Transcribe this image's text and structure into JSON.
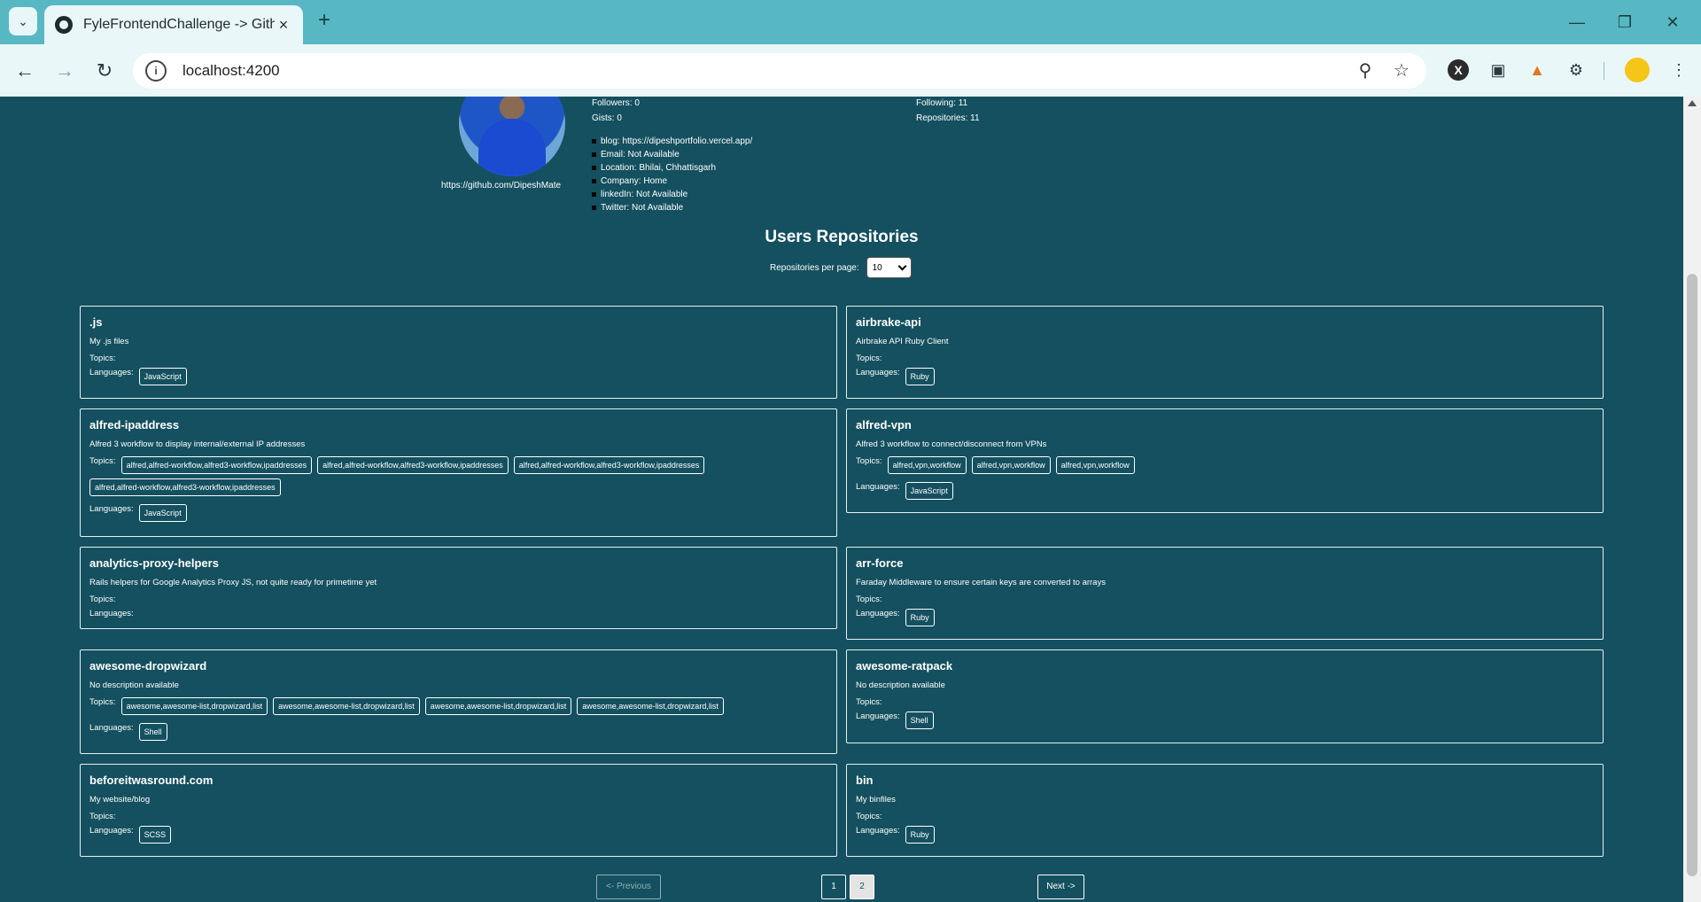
{
  "browser": {
    "tab_title": "FyleFrontendChallenge -> Githu",
    "url": "localhost:4200"
  },
  "profile": {
    "github_url": "https://github.com/DipeshMate",
    "followers": "Followers: 0",
    "gists": "Gists: 0",
    "following": "Following: 11",
    "repositories": "Repositories: 11",
    "info": [
      "blog: https://dipeshportfolio.vercel.app/",
      "Email: Not Available",
      "Location: Bhilai, Chhattisgarh",
      "Company: Home",
      "linkedIn: Not Available",
      "Twitter:  Not Available"
    ]
  },
  "section_title": "Users Repositories",
  "per_page_label": "Repositories per page:",
  "per_page_value": "10",
  "topics_label": "Topics:",
  "languages_label": "Languages:",
  "repos": [
    {
      "name": ".js",
      "description": "My .js files",
      "topics": [],
      "languages": [
        "JavaScript"
      ]
    },
    {
      "name": "airbrake-api",
      "description": "Airbrake API Ruby Client",
      "topics": [],
      "languages": [
        "Ruby"
      ]
    },
    {
      "name": "alfred-ipaddress",
      "description": "Alfred 3 workflow to display internal/external IP addresses",
      "topics": [
        "alfred,alfred-workflow,alfred3-workflow,ipaddresses",
        "alfred,alfred-workflow,alfred3-workflow,ipaddresses",
        "alfred,alfred-workflow,alfred3-workflow,ipaddresses",
        "alfred,alfred-workflow,alfred3-workflow,ipaddresses"
      ],
      "languages": [
        "JavaScript"
      ]
    },
    {
      "name": "alfred-vpn",
      "description": "Alfred 3 workflow to connect/disconnect from VPNs",
      "topics": [
        "alfred,vpn,workflow",
        "alfred,vpn,workflow",
        "alfred,vpn,workflow"
      ],
      "languages": [
        "JavaScript"
      ]
    },
    {
      "name": "analytics-proxy-helpers",
      "description": "Rails helpers for Google Analytics Proxy JS, not quite ready for primetime yet",
      "topics": [],
      "languages": []
    },
    {
      "name": "arr-force",
      "description": "Faraday Middleware to ensure certain keys are converted to arrays",
      "topics": [],
      "languages": [
        "Ruby"
      ]
    },
    {
      "name": "awesome-dropwizard",
      "description": "No description available",
      "topics": [
        "awesome,awesome-list,dropwizard,list",
        "awesome,awesome-list,dropwizard,list",
        "awesome,awesome-list,dropwizard,list",
        "awesome,awesome-list,dropwizard,list"
      ],
      "languages": [
        "Shell"
      ]
    },
    {
      "name": "awesome-ratpack",
      "description": "No description available",
      "topics": [],
      "languages": [
        "Shell"
      ]
    },
    {
      "name": "beforeitwasround.com",
      "description": "My website/blog",
      "topics": [],
      "languages": [
        "SCSS"
      ]
    },
    {
      "name": "bin",
      "description": "My binfiles",
      "topics": [],
      "languages": [
        "Ruby"
      ]
    }
  ],
  "pagination": {
    "previous": "<- Previous",
    "next": "Next ->",
    "pages": [
      "1",
      "2"
    ],
    "active_page": "2"
  }
}
